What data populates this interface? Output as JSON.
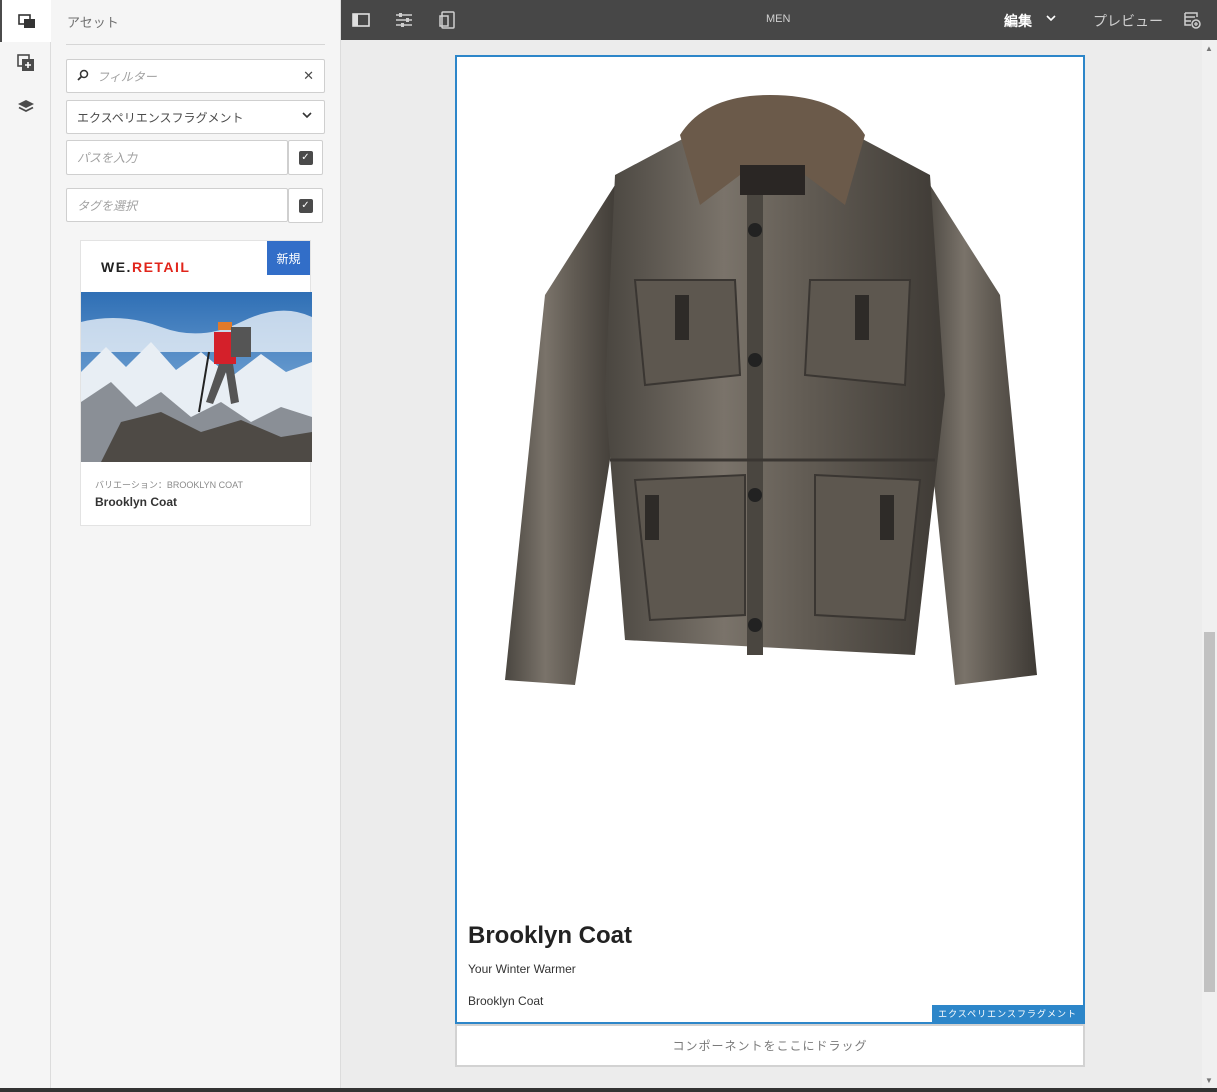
{
  "rail": {
    "items": [
      {
        "icon": "assets-icon",
        "active": true
      },
      {
        "icon": "components-icon",
        "active": false
      },
      {
        "icon": "layers-icon",
        "active": false
      }
    ]
  },
  "panel": {
    "title": "アセット",
    "search_placeholder": "フィルター",
    "type_select": "エクスペリエンスフラグメント",
    "path_placeholder": "パスを入力",
    "tag_placeholder": "タグを選択",
    "card": {
      "logo_a": "WE.",
      "logo_b": "RETAIL",
      "badge": "新規",
      "variation": "バリエーション：BROOKLYN COAT",
      "name": "Brooklyn Coat"
    }
  },
  "toolbar": {
    "title": "MEN",
    "mode": "編集",
    "preview": "プレビュー"
  },
  "page": {
    "product_title": "Brooklyn Coat",
    "product_subtitle": "Your Winter Warmer",
    "product_name": "Brooklyn Coat",
    "fragment_label": "エクスペリエンスフラグメント",
    "drop_hint": "コンポーネントをここにドラッグ"
  },
  "colors": {
    "toolbar_bg": "#474747",
    "accent_blue": "#2d86c9",
    "badge_blue": "#326ec8",
    "logo_red": "#e1251b"
  }
}
